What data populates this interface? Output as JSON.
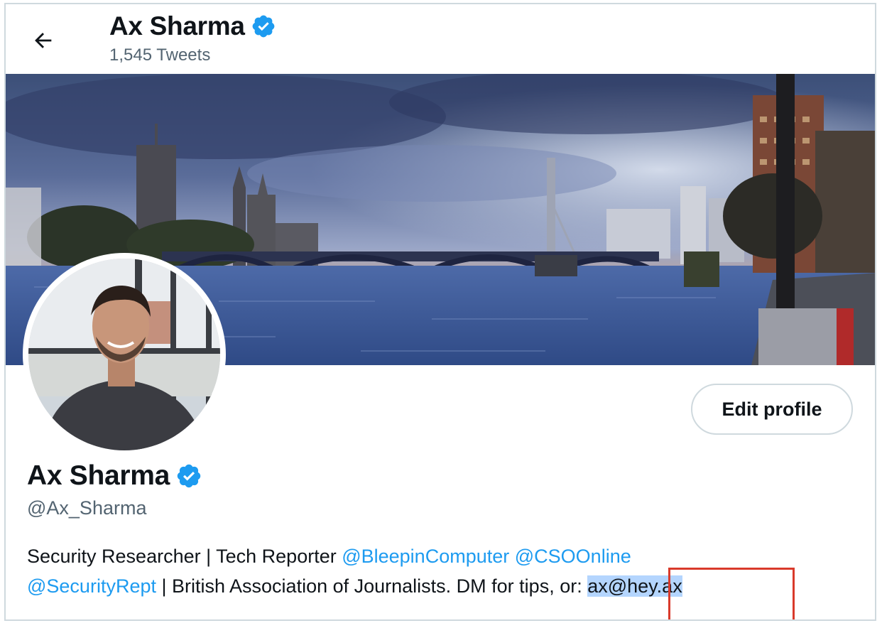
{
  "header": {
    "name": "Ax Sharma",
    "tweets_count": "1,545 Tweets"
  },
  "icons": {
    "back": "arrow-left-icon",
    "verified": "verified-badge-icon"
  },
  "profile": {
    "name": "Ax Sharma",
    "handle": "@Ax_Sharma",
    "edit_label": "Edit profile",
    "bio": {
      "text1": "Security Researcher | Tech Reporter ",
      "mention1": "@BleepinComputer",
      "space1": " ",
      "mention2": "@CSOOnline",
      "mention3": "@SecurityRept",
      "text2": " | British Association of Journalists. DM for tips, or: ",
      "email": "ax@hey.ax"
    }
  },
  "colors": {
    "accent": "#1d9bf0",
    "text": "#0f1419",
    "secondary": "#536471",
    "highlight_box": "#d93a2b",
    "selection": "#b4d5fe"
  }
}
